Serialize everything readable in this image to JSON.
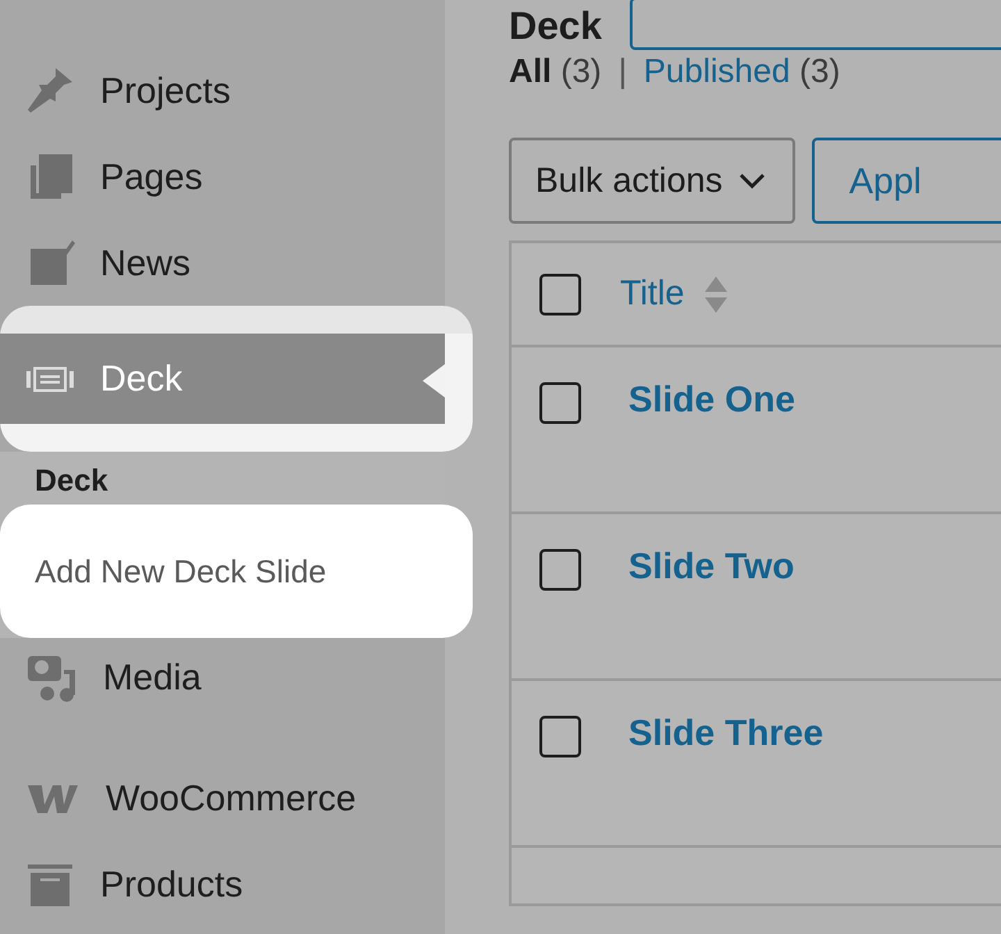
{
  "page": {
    "heading": "Deck"
  },
  "sidebar": {
    "items": [
      {
        "label": "Projects",
        "selected": false,
        "highlighted": false
      },
      {
        "label": "Pages",
        "selected": false,
        "highlighted": false
      },
      {
        "label": "News",
        "selected": false,
        "highlighted": false
      },
      {
        "label": "Deck",
        "selected": true,
        "highlighted": true,
        "submenu": {
          "heading": "Deck",
          "items": [
            {
              "label": "Add New Deck Slide",
              "selected": false,
              "highlighted": true
            }
          ]
        }
      },
      {
        "label": "Media",
        "selected": false,
        "highlighted": false
      },
      {
        "label": "WooCommerce",
        "selected": false,
        "highlighted": false
      },
      {
        "label": "Products",
        "selected": false,
        "highlighted": false
      }
    ]
  },
  "filters": {
    "separator": "|",
    "items": [
      {
        "label": "All",
        "count": "(3)",
        "selected": true
      },
      {
        "label": "Published",
        "count": "(3)",
        "selected": false
      }
    ]
  },
  "bulk_actions": {
    "value": "Bulk actions"
  },
  "apply_button": "Appl",
  "table": {
    "select_all_checked": false,
    "columns": [
      {
        "label": "Title",
        "sortable": true
      }
    ],
    "rows": [
      {
        "title": "Slide One",
        "checked": false
      },
      {
        "title": "Slide Two",
        "checked": false
      },
      {
        "title": "Slide Three",
        "checked": false
      }
    ]
  }
}
